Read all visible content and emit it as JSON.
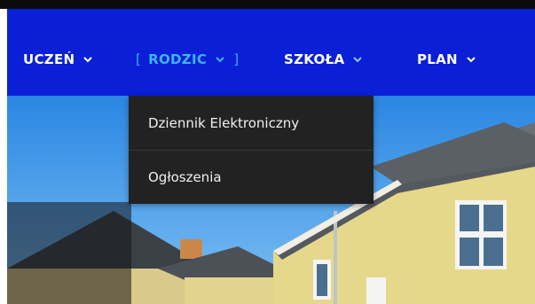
{
  "nav": {
    "items": [
      {
        "label": "UCZEŃ"
      },
      {
        "label": "RODZIC",
        "bracket_open": "[",
        "bracket_close": "]"
      },
      {
        "label": "SZKOŁA"
      },
      {
        "label": "PLAN"
      }
    ]
  },
  "dropdown": {
    "items": [
      {
        "label": "Dziennik Elektroniczny"
      },
      {
        "label": "Ogłoszenia"
      }
    ]
  },
  "colors": {
    "nav_bg": "#0a1fd6",
    "active": "#3fb4ff",
    "dropdown_bg": "#222222"
  },
  "icons": [
    "chevron-down-icon"
  ]
}
